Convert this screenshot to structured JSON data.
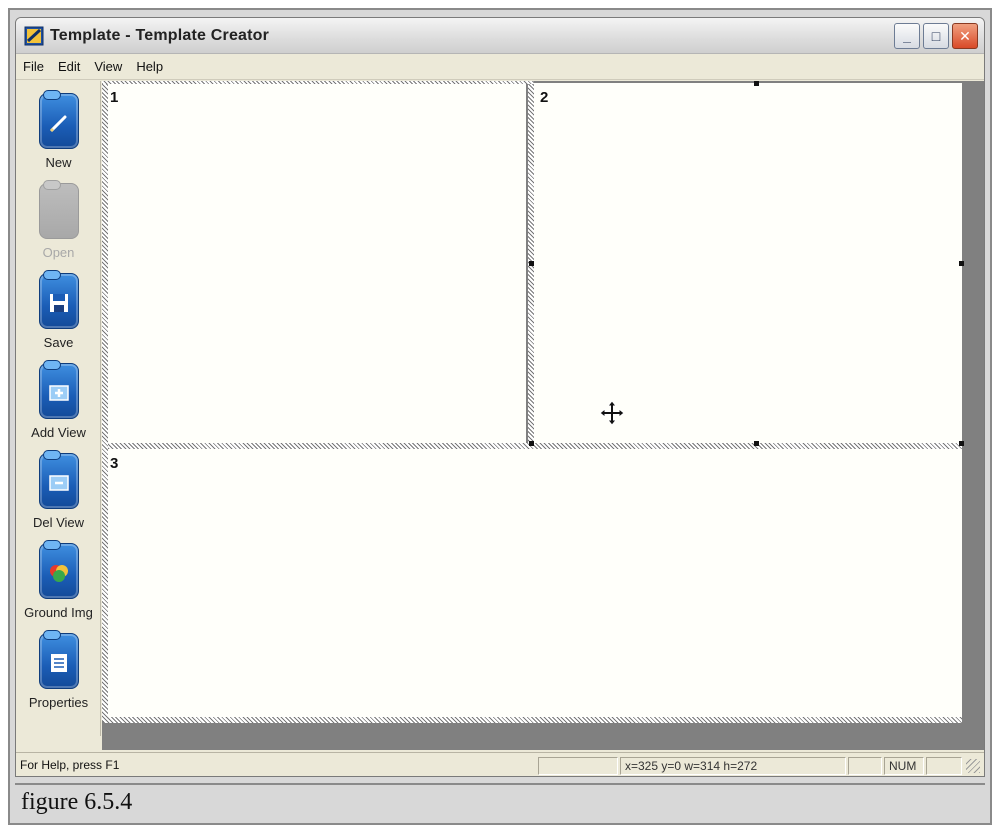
{
  "window": {
    "title": "Template - Template Creator",
    "controls": {
      "minimize": "_",
      "maximize": "□",
      "close": "✕"
    }
  },
  "menu": [
    "File",
    "Edit",
    "View",
    "Help"
  ],
  "toolbar": {
    "buttons": [
      {
        "label": "New",
        "icon": "pencil-icon",
        "enabled": true
      },
      {
        "label": "Open",
        "icon": "folder-icon",
        "enabled": false
      },
      {
        "label": "Save",
        "icon": "floppy-disk-icon",
        "enabled": true
      },
      {
        "label": "Add View",
        "icon": "plus-icon",
        "enabled": true
      },
      {
        "label": "Del View",
        "icon": "minus-icon",
        "enabled": true
      },
      {
        "label": "Ground Img",
        "icon": "ground-image-icon",
        "enabled": true
      },
      {
        "label": "Properties",
        "icon": "properties-sheet-icon",
        "enabled": true
      }
    ]
  },
  "views": [
    {
      "number": "1"
    },
    {
      "number": "2"
    },
    {
      "number": "3"
    }
  ],
  "status": {
    "help": "For Help, press F1",
    "coords": "x=325 y=0 w=314 h=272",
    "num": "NUM"
  },
  "caption": "figure 6.5.4",
  "colors": {
    "icon_blue": "#1b5db6",
    "canvas_bg": "#808080",
    "view_bg": "#fffffa",
    "close_red": "#d94a28"
  }
}
